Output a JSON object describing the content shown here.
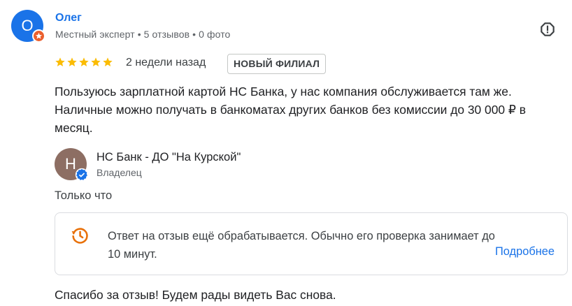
{
  "review": {
    "author": {
      "initial": "О",
      "name": "Олег",
      "meta": "Местный эксперт • 5 отзывов • 0 фото"
    },
    "rating": 5,
    "date": "2 недели назад",
    "badge": "НОВЫЙ ФИЛИАЛ",
    "text": "Пользуюсь зарплатной картой НС Банка, у нас компания обслуживается там же. Наличные можно получать в банкоматах других банков без комиссии до 30 000 ₽ в месяц."
  },
  "owner_reply": {
    "initial": "Н",
    "name": "НС Банк - ДО \"На Курской\"",
    "role": "Владелец",
    "time": "Только что",
    "notice": {
      "text": "Ответ на отзыв ещё обрабатывается. Обычно его проверка занимает до 10 минут.",
      "link": "Подробнее"
    },
    "text": "Спасибо за отзыв! Будем рады видеть Вас снова."
  },
  "colors": {
    "accent": "#1a73e8",
    "star": "#fbbc04",
    "guide_badge": "#ea5f2d",
    "pending_icon": "#e8710a",
    "owner_avatar": "#8d6e63"
  },
  "icons": {
    "report": "report-flag-icon",
    "pending": "clock-history-icon",
    "verified": "verified-check-icon",
    "guide": "local-guide-icon"
  }
}
